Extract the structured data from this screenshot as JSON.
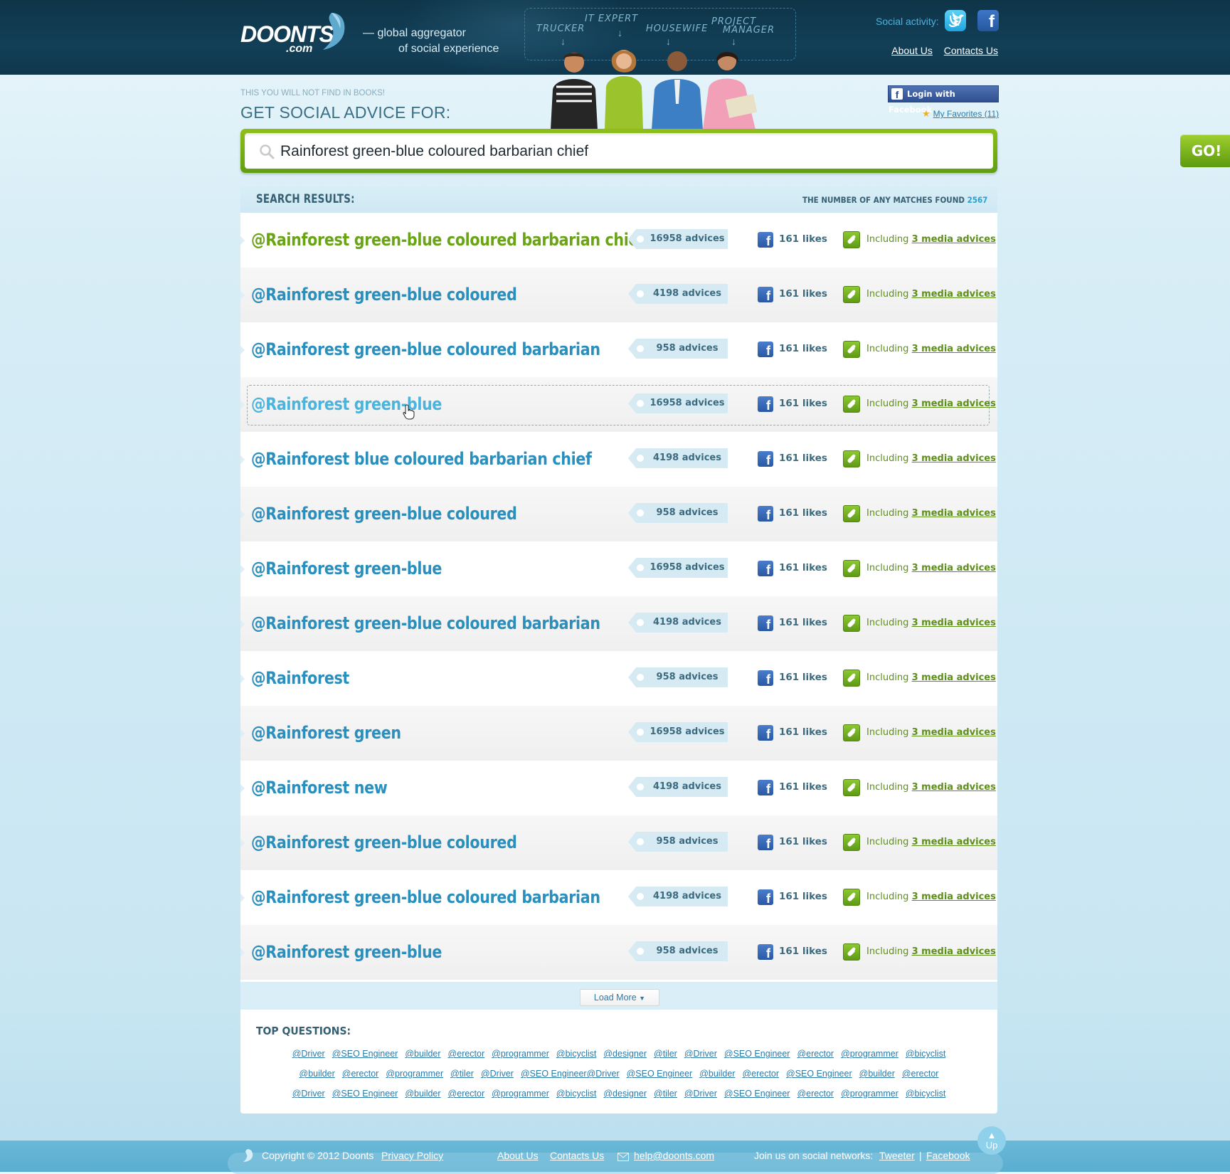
{
  "header": {
    "logo_text": "DOONTS",
    "logo_sub": ".com",
    "tagline_line1": "— global aggregator",
    "tagline_line2": "of social experience",
    "roles": [
      "TRUCKER",
      "IT EXPERT",
      "HOUSEWIFE",
      "PROJECT",
      "MANAGER"
    ],
    "social_label": "Social activity:",
    "nav": [
      "About Us",
      "Contacts Us"
    ]
  },
  "advice": {
    "hint": "THIS YOU WILL NOT FIND IN BOOKS!",
    "title": "GET SOCIAL ADVICE FOR:",
    "fb_login": "Login with Facebook",
    "favorites_label": "My Favorites",
    "favorites_count": "(11)"
  },
  "search": {
    "value": "Rainforest green-blue coloured barbarian chief",
    "go_label": "GO!"
  },
  "results": {
    "title": "SEARCH RESULTS:",
    "matches_label": "THE NUMBER OF ANY MATCHES FOUND",
    "matches_count": "2567",
    "including_label": "Including",
    "items": [
      {
        "title": "@Rainforest green-blue coloured barbarian chief",
        "advices": "16958 advices",
        "likes": "161 likes",
        "media": "3 media advices"
      },
      {
        "title": "@Rainforest green-blue coloured",
        "advices": "4198 advices",
        "likes": "161 likes",
        "media": "3 media advices"
      },
      {
        "title": "@Rainforest green-blue coloured barbarian",
        "advices": "958 advices",
        "likes": "161 likes",
        "media": "3 media advices"
      },
      {
        "title": "@Rainforest green-blue",
        "advices": "16958 advices",
        "likes": "161 likes",
        "media": "3 media advices"
      },
      {
        "title": "@Rainforest blue coloured barbarian chief",
        "advices": "4198 advices",
        "likes": "161 likes",
        "media": "3 media advices"
      },
      {
        "title": "@Rainforest green-blue coloured",
        "advices": "958 advices",
        "likes": "161 likes",
        "media": "3 media advices"
      },
      {
        "title": "@Rainforest green-blue",
        "advices": "16958 advices",
        "likes": "161 likes",
        "media": "3 media advices"
      },
      {
        "title": "@Rainforest green-blue coloured barbarian",
        "advices": "4198 advices",
        "likes": "161 likes",
        "media": "3 media advices"
      },
      {
        "title": "@Rainforest",
        "advices": "958 advices",
        "likes": "161 likes",
        "media": "3 media advices"
      },
      {
        "title": "@Rainforest green",
        "advices": "16958 advices",
        "likes": "161 likes",
        "media": "3 media advices"
      },
      {
        "title": "@Rainforest new",
        "advices": "4198 advices",
        "likes": "161 likes",
        "media": "3 media advices"
      },
      {
        "title": "@Rainforest green-blue coloured",
        "advices": "958 advices",
        "likes": "161 likes",
        "media": "3 media advices"
      },
      {
        "title": "@Rainforest green-blue coloured barbarian",
        "advices": "4198 advices",
        "likes": "161 likes",
        "media": "3 media advices"
      },
      {
        "title": "@Rainforest green-blue",
        "advices": "958 advices",
        "likes": "161 likes",
        "media": "3 media advices"
      }
    ],
    "load_more": "Load More"
  },
  "top_questions": {
    "title": "TOP QUESTIONS:",
    "rows": [
      [
        "@Driver",
        "@SEO Engineer",
        "@builder",
        "@erector",
        "@programmer",
        "@bicyclist",
        "@designer",
        "@tiler",
        "@Driver",
        "@SEO Engineer",
        "@erector",
        "@programmer",
        "@bicyclist"
      ],
      [
        "@builder",
        "@erector",
        "@programmer",
        "@tiler",
        "@Driver",
        "@SEO Engineer@Driver",
        "@SEO Engineer",
        "@builder",
        "@erector",
        "@SEO Engineer",
        "@builder",
        "@erector"
      ],
      [
        "@Driver",
        "@SEO Engineer",
        "@builder",
        "@erector",
        "@programmer",
        "@bicyclist",
        "@designer",
        "@tiler",
        "@Driver",
        "@SEO Engineer",
        "@erector",
        "@programmer",
        "@bicyclist"
      ]
    ]
  },
  "footer": {
    "copyright": "Copyright © 2012 Doonts",
    "privacy": "Privacy Policy",
    "about": "About Us",
    "contacts": "Contacts Us",
    "email": "help@doonts.com",
    "join_label": "Join us on social networks:",
    "tweeter": "Tweeter",
    "separator": "|",
    "facebook": "Facebook",
    "up": "Up"
  },
  "colors": {
    "header_bg": "#123f57",
    "accent_green": "#6aa316",
    "title_blue": "#2b8fbe",
    "footer_bg": "#5aaed0"
  }
}
